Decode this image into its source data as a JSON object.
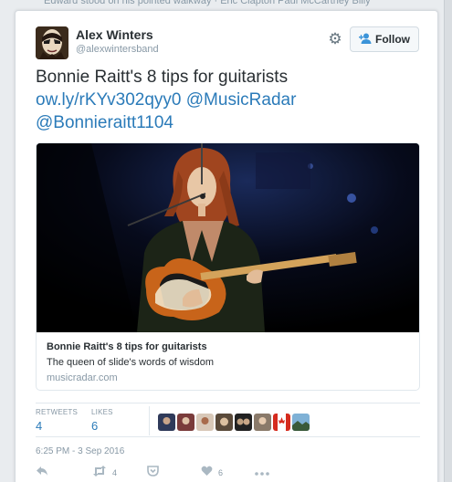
{
  "top_strip": {
    "text": "Edward stood on his pointed walkway · Eric Clapton Paul McCartney Billy"
  },
  "author": {
    "name": "Alex Winters",
    "handle": "@alexwintersband"
  },
  "follow_button": {
    "label": "Follow"
  },
  "tweet": {
    "text_main": "Bonnie Raitt's 8 tips for guitarists",
    "link": "ow.ly/rKYv302qyy0",
    "mention1": "@MusicRadar",
    "mention2": "@Bonnieraitt1104"
  },
  "card": {
    "title": "Bonnie Raitt's 8 tips for guitarists",
    "description": "The queen of slide's words of wisdom",
    "domain": "musicradar.com"
  },
  "stats": {
    "retweets_label": "RETWEETS",
    "retweets_value": "4",
    "likes_label": "LIKES",
    "likes_value": "6"
  },
  "liker_avatars": [
    "avatar-1",
    "avatar-2",
    "avatar-3",
    "avatar-4",
    "avatar-5",
    "avatar-6",
    "avatar-canada-flag",
    "avatar-landscape"
  ],
  "timestamp": "6:25 PM - 3 Sep 2016",
  "actions": {
    "retweet_count": "4",
    "like_count": "6"
  },
  "colors": {
    "link": "#2b7bb9",
    "text": "#292f33",
    "muted": "#8899a6",
    "follow_icon": "#3b94d9"
  }
}
